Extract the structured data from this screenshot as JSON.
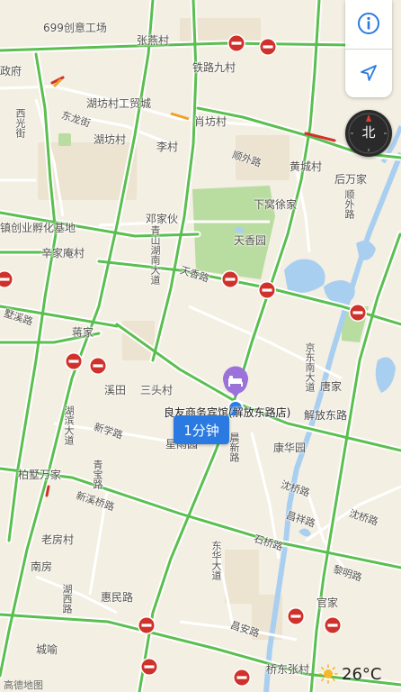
{
  "map": {
    "colors": {
      "land": "#f3efe3",
      "road": "#5bbf4f",
      "road_edge": "#ffffff",
      "park": "#b9dca0",
      "water": "#a9cff0",
      "congestion": "#d0322b",
      "accent": "#2a7ae2",
      "poi": "#9b72d9"
    },
    "labels": [
      {
        "text": "699创意工场"
      },
      {
        "text": "张燕村"
      },
      {
        "text": "政府"
      },
      {
        "text": "铁路九村"
      },
      {
        "text": "湖坊村工贸城"
      },
      {
        "text": "肖坊村"
      },
      {
        "text": "西光街"
      },
      {
        "text": "东龙街"
      },
      {
        "text": "湖坊村"
      },
      {
        "text": "李村"
      },
      {
        "text": "顺外路"
      },
      {
        "text": "黄城村"
      },
      {
        "text": "后万家"
      },
      {
        "text": "顺外路"
      },
      {
        "text": "下窝徐家"
      },
      {
        "text": "邓家伙"
      },
      {
        "text": "镇创业孵化基地"
      },
      {
        "text": "辛家庵村"
      },
      {
        "text": "天香园"
      },
      {
        "text": "天香路"
      },
      {
        "text": "青山湖南大道"
      },
      {
        "text": "墅溪路"
      },
      {
        "text": "蒋家"
      },
      {
        "text": "京东南大道"
      },
      {
        "text": "唐家"
      },
      {
        "text": "溪田"
      },
      {
        "text": "三头村"
      },
      {
        "text": "新学路"
      },
      {
        "text": "湖滨大道"
      },
      {
        "text": "解放东路"
      },
      {
        "text": "康华园"
      },
      {
        "text": "青宝路"
      },
      {
        "text": "星雨园"
      },
      {
        "text": "晨新路"
      },
      {
        "text": "柏墅万家"
      },
      {
        "text": "沈桥路"
      },
      {
        "text": "新溪桥路"
      },
      {
        "text": "昌祥路"
      },
      {
        "text": "沈桥路"
      },
      {
        "text": "老房村"
      },
      {
        "text": "石桥路"
      },
      {
        "text": "东华大道"
      },
      {
        "text": "南房"
      },
      {
        "text": "黎明路"
      },
      {
        "text": "湖西路"
      },
      {
        "text": "惠民路"
      },
      {
        "text": "官家"
      },
      {
        "text": "昌安路"
      },
      {
        "text": "城喻"
      },
      {
        "text": "桥东张村"
      }
    ],
    "poi": {
      "name": "良友商务宾馆(解放东路店)",
      "icon": "hotel-bed-icon"
    },
    "eta": "1分钟",
    "controls": {
      "info_icon": "info-icon",
      "locate_icon": "location-arrow-icon",
      "compass_letter": "北"
    },
    "weather": {
      "icon": "sun-icon",
      "temperature": "26°C"
    },
    "attribution": "高德地图"
  }
}
